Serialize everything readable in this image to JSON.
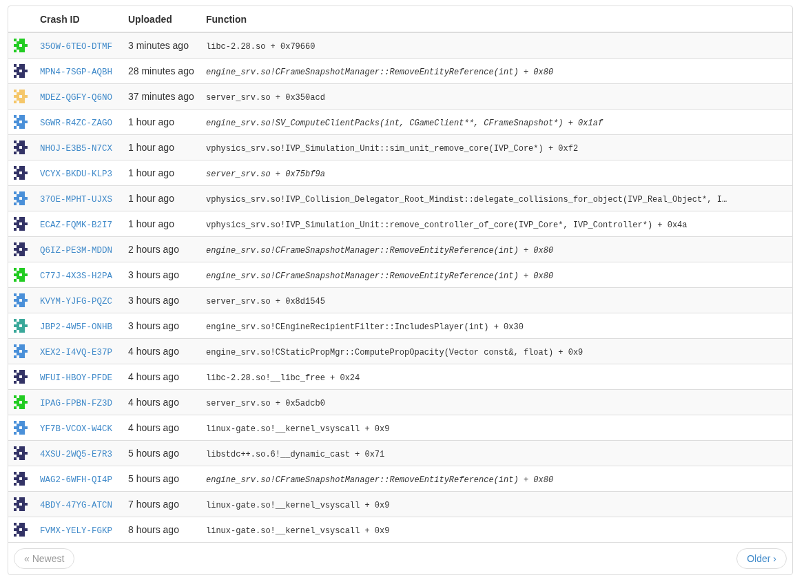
{
  "table": {
    "columns": [
      "Crash ID",
      "Uploaded",
      "Function"
    ],
    "rows": [
      {
        "color": "#22cc22",
        "crash_id": "35OW-6TEO-DTMF",
        "uploaded": "3 minutes ago",
        "function": "libc-2.28.so + 0x79660",
        "italic": false
      },
      {
        "color": "#333366",
        "crash_id": "MPN4-7SGP-AQBH",
        "uploaded": "28 minutes ago",
        "function": "engine_srv.so!CFrameSnapshotManager::RemoveEntityReference(int) + 0x80",
        "italic": true
      },
      {
        "color": "#f5c76a",
        "crash_id": "MDEZ-QGFY-Q6NO",
        "uploaded": "37 minutes ago",
        "function": "server_srv.so + 0x350acd",
        "italic": false
      },
      {
        "color": "#4a90d9",
        "crash_id": "SGWR-R4ZC-ZAGO",
        "uploaded": "1 hour ago",
        "function": "engine_srv.so!SV_ComputeClientPacks(int, CGameClient**, CFrameSnapshot*) + 0x1af",
        "italic": true
      },
      {
        "color": "#333366",
        "crash_id": "NHOJ-E3B5-N7CX",
        "uploaded": "1 hour ago",
        "function": "vphysics_srv.so!IVP_Simulation_Unit::sim_unit_remove_core(IVP_Core*) + 0xf2",
        "italic": false
      },
      {
        "color": "#333366",
        "crash_id": "VCYX-BKDU-KLP3",
        "uploaded": "1 hour ago",
        "function": "server_srv.so + 0x75bf9a",
        "italic": true
      },
      {
        "color": "#4a90d9",
        "crash_id": "37OE-MPHT-UJXS",
        "uploaded": "1 hour ago",
        "function": "vphysics_srv.so!IVP_Collision_Delegator_Root_Mindist::delegate_collisions_for_object(IVP_Real_Object*, I…",
        "italic": false
      },
      {
        "color": "#333366",
        "crash_id": "ECAZ-FQMK-B2I7",
        "uploaded": "1 hour ago",
        "function": "vphysics_srv.so!IVP_Simulation_Unit::remove_controller_of_core(IVP_Core*, IVP_Controller*) + 0x4a",
        "italic": false
      },
      {
        "color": "#333366",
        "crash_id": "Q6IZ-PE3M-MDDN",
        "uploaded": "2 hours ago",
        "function": "engine_srv.so!CFrameSnapshotManager::RemoveEntityReference(int) + 0x80",
        "italic": true
      },
      {
        "color": "#22cc22",
        "crash_id": "C77J-4X3S-H2PA",
        "uploaded": "3 hours ago",
        "function": "engine_srv.so!CFrameSnapshotManager::RemoveEntityReference(int) + 0x80",
        "italic": true
      },
      {
        "color": "#4a90d9",
        "crash_id": "KVYM-YJFG-PQZC",
        "uploaded": "3 hours ago",
        "function": "server_srv.so + 0x8d1545",
        "italic": false
      },
      {
        "color": "#3aa89a",
        "crash_id": "JBP2-4W5F-ONHB",
        "uploaded": "3 hours ago",
        "function": "engine_srv.so!CEngineRecipientFilter::IncludesPlayer(int) + 0x30",
        "italic": false
      },
      {
        "color": "#4a90d9",
        "crash_id": "XEX2-I4VQ-E37P",
        "uploaded": "4 hours ago",
        "function": "engine_srv.so!CStaticPropMgr::ComputePropOpacity(Vector const&, float) + 0x9",
        "italic": false
      },
      {
        "color": "#333366",
        "crash_id": "WFUI-HBOY-PFDE",
        "uploaded": "4 hours ago",
        "function": "libc-2.28.so!__libc_free + 0x24",
        "italic": false
      },
      {
        "color": "#22cc22",
        "crash_id": "IPAG-FPBN-FZ3D",
        "uploaded": "4 hours ago",
        "function": "server_srv.so + 0x5adcb0",
        "italic": false
      },
      {
        "color": "#4a90d9",
        "crash_id": "YF7B-VCOX-W4CK",
        "uploaded": "4 hours ago",
        "function": "linux-gate.so!__kernel_vsyscall + 0x9",
        "italic": false
      },
      {
        "color": "#333366",
        "crash_id": "4XSU-2WQ5-E7R3",
        "uploaded": "5 hours ago",
        "function": "libstdc++.so.6!__dynamic_cast + 0x71",
        "italic": false
      },
      {
        "color": "#333366",
        "crash_id": "WAG2-6WFH-QI4P",
        "uploaded": "5 hours ago",
        "function": "engine_srv.so!CFrameSnapshotManager::RemoveEntityReference(int) + 0x80",
        "italic": true
      },
      {
        "color": "#333366",
        "crash_id": "4BDY-47YG-ATCN",
        "uploaded": "7 hours ago",
        "function": "linux-gate.so!__kernel_vsyscall + 0x9",
        "italic": false
      },
      {
        "color": "#333366",
        "crash_id": "FVMX-YELY-FGKP",
        "uploaded": "8 hours ago",
        "function": "linux-gate.so!__kernel_vsyscall + 0x9",
        "italic": false
      }
    ]
  },
  "pager": {
    "newer": {
      "icon": "«",
      "label": "Newest",
      "disabled": true
    },
    "older": {
      "icon": "›",
      "label": "Older",
      "disabled": false
    }
  }
}
